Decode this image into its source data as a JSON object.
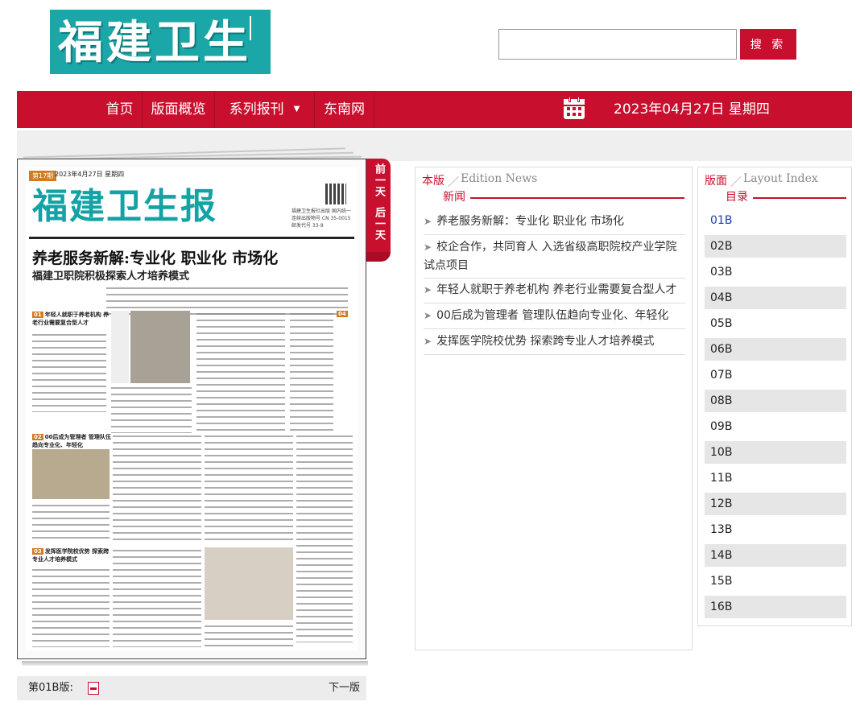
{
  "header": {
    "logo_text": "福建卫生报",
    "search_placeholder": "",
    "search_label": "搜 索"
  },
  "nav": {
    "items": [
      {
        "label": "首页"
      },
      {
        "label": "版面概览"
      },
      {
        "label": "系列报刊"
      },
      {
        "label": "东南网"
      }
    ],
    "date": "2023年04月27日 星期四"
  },
  "paper": {
    "edition_tag": "第17期",
    "date_line": "2023年4月27日  星期四",
    "masthead": "福建卫生报",
    "headline": "养老服务新解:专业化  职业化  市场化",
    "subheadline": "福建卫职院积极探索人才培养模式",
    "section1": "年轻人就职于养老机构 养老行业需要复合型人才",
    "section2": "00后成为管理者 管理队伍趋向专业化、年轻化",
    "section3": "发挥医学院校优势 探索跨专业人才培养模式",
    "side_section": "校企合作 共同育人 入选省级高职院校产业学院试点项目",
    "sidebar_text": "福建卫生报社出版 国内统一连续出版物号 CN 35-0015 邮发代号 33-9"
  },
  "page_tab": {
    "prev": "前一天",
    "next": "后一天"
  },
  "footer": {
    "current_page": "第01B版:",
    "next_page": "下一版"
  },
  "news_panel": {
    "title_cn1": "本版",
    "title_en": "Edition News",
    "title_cn2": "新闻",
    "items": [
      {
        "title": "养老服务新解：专业化 职业化 市场化"
      },
      {
        "title": "校企合作，共同育人 入选省级高职院校产业学院试点项目"
      },
      {
        "title": "年轻人就职于养老机构 养老行业需要复合型人才"
      },
      {
        "title": "00后成为管理者 管理队伍趋向专业化、年轻化"
      },
      {
        "title": "发挥医学院校优势 探索跨专业人才培养模式"
      }
    ]
  },
  "index_panel": {
    "title_cn1": "版面",
    "title_en": "Layout Index",
    "title_cn2": "目录",
    "items": [
      "01B",
      "02B",
      "03B",
      "04B",
      "05B",
      "06B",
      "07B",
      "08B",
      "09B",
      "10B",
      "11B",
      "12B",
      "13B",
      "14B",
      "15B",
      "16B"
    ]
  }
}
